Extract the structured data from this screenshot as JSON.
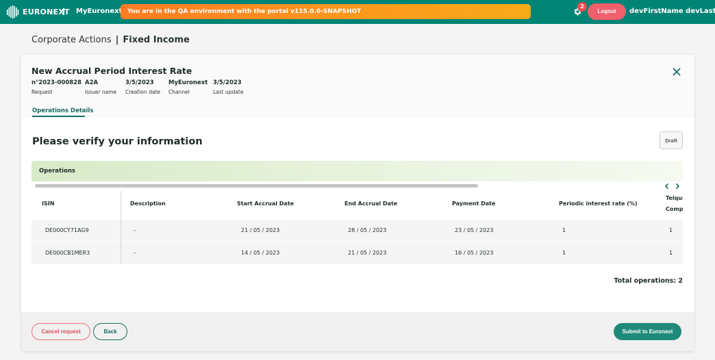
{
  "topbar": {
    "logo_text": "EURONEXT",
    "app_name": "MyEuronext",
    "env_banner": "You are in the QA environment with the portal v115.0.0-SNAPSHOT",
    "settings_badge": "2",
    "logout_label": "Logout",
    "username": "devFirstName devLastName",
    "colors": {
      "bar": "#008476",
      "banner": "#fc9a1e",
      "logout": "#f0606c"
    }
  },
  "breadcrumb": {
    "parent": "Corporate Actions",
    "separator": "|",
    "current": "Fixed Income"
  },
  "request": {
    "title": "New Accrual Period Interest Rate",
    "meta": [
      {
        "value": "n°2023-000828",
        "label": "Request"
      },
      {
        "value": "A2A",
        "label": "Issuer name"
      },
      {
        "value": "3/5/2023",
        "label": "Creation date"
      },
      {
        "value": "MyEuronext",
        "label": "Channel"
      },
      {
        "value": "3/5/2023",
        "label": "Last update"
      }
    ],
    "tab": "Operations Details"
  },
  "main": {
    "heading": "Please verify your information",
    "draft_label": "Draft",
    "operations_label": "Operations",
    "table": {
      "columns": [
        "ISIN",
        "Description",
        "Start Accrual Date",
        "End Accrual Date",
        "Payment Date",
        "Periodic interest rate (%)",
        "Telque",
        "Compo"
      ],
      "rows": [
        [
          "DE000CY71AG9",
          "-",
          "21 / 05 / 2023",
          "28 / 05 / 2023",
          "23 / 05 / 2023",
          "1",
          "1"
        ],
        [
          "DE000CB1MER3",
          "-",
          "14 / 05 / 2023",
          "21 / 05 / 2023",
          "16 / 05 / 2023",
          "1",
          "1"
        ]
      ]
    },
    "total_operations": "Total operations: 2"
  },
  "footer": {
    "cancel_label": "Cancel request",
    "back_label": "Back",
    "submit_label": "Submit to Euronext"
  }
}
